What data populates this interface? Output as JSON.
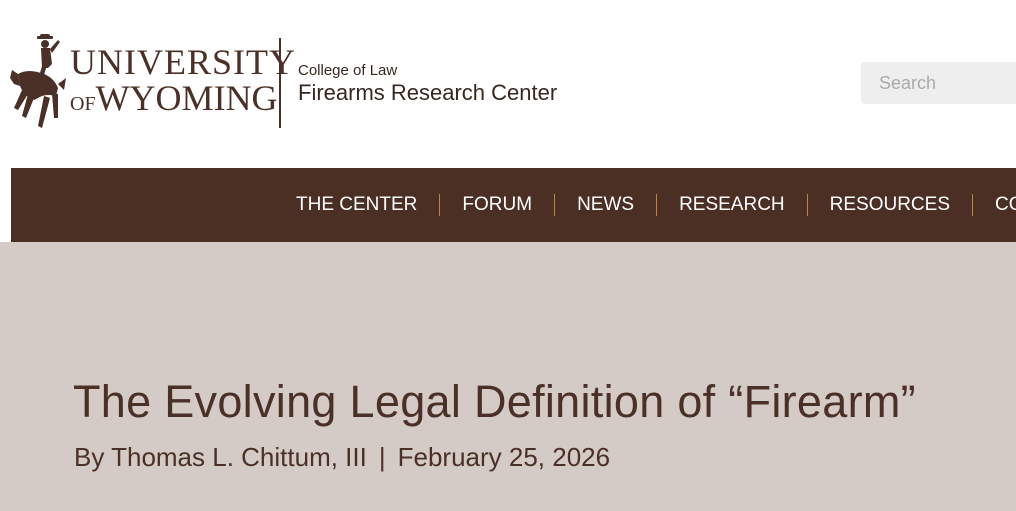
{
  "header": {
    "logo_alt": "University of Wyoming",
    "wordmark_line1": "UNIVERSITY",
    "wordmark_of": "OF",
    "wordmark_line2": "WYOMING",
    "college": "College of Law",
    "center": "Firearms Research Center",
    "search_placeholder": "Search"
  },
  "nav": {
    "items": [
      {
        "label": "THE CENTER"
      },
      {
        "label": "FORUM"
      },
      {
        "label": "NEWS"
      },
      {
        "label": "RESEARCH"
      },
      {
        "label": "RESOURCES"
      },
      {
        "label": "CONN"
      }
    ]
  },
  "article": {
    "title": "The Evolving Legal Definition of “Firearm”",
    "author": "By Thomas L. Chittum, III",
    "separator": "|",
    "date": "February 25, 2026"
  },
  "colors": {
    "brown": "#4b2e24",
    "gold_divider": "#b98a3c",
    "hero_bg": "#d4cbc6"
  },
  "icons": {
    "logo": "bucking-horse-rider-icon"
  }
}
